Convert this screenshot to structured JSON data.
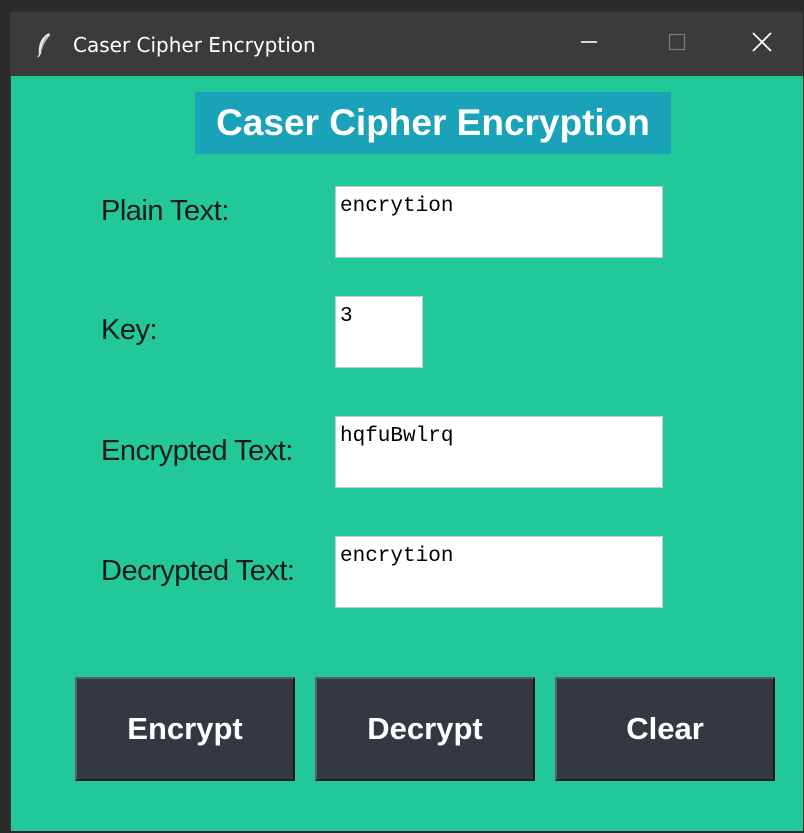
{
  "window": {
    "title": "Caser Cipher Encryption"
  },
  "app": {
    "heading": "Caser Cipher Encryption"
  },
  "fields": {
    "plain_text": {
      "label": "Plain Text:",
      "value": "encrytion"
    },
    "key": {
      "label": "Key:",
      "value": "3"
    },
    "encrypted_text": {
      "label": "Encrypted Text:",
      "value": "hqfuBwlrq"
    },
    "decrypted_text": {
      "label": "Decrypted Text:",
      "value": "encrytion"
    }
  },
  "buttons": {
    "encrypt": "Encrypt",
    "decrypt": "Decrypt",
    "clear": "Clear"
  },
  "icons": {
    "app": "feather-icon",
    "minimize": "minimize-icon",
    "maximize": "maximize-icon",
    "close": "close-icon"
  },
  "colors": {
    "background": "#23c899",
    "heading_bg": "#1aa3b8",
    "button_bg": "#343840",
    "titlebar_bg": "#3b3b3b"
  }
}
